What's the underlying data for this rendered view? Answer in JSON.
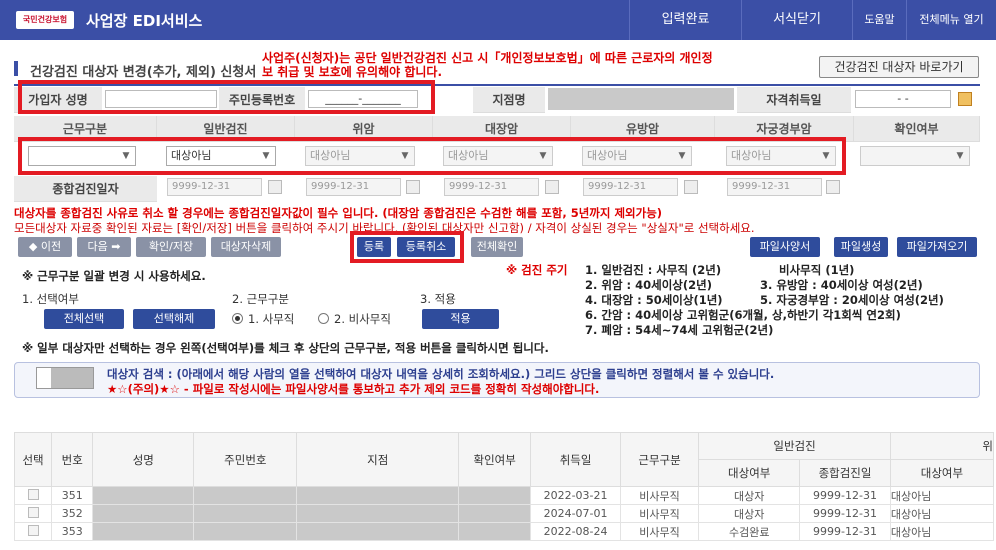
{
  "topbar": {
    "logo_text": "국민건강보험",
    "service": "사업장 EDI서비스",
    "menu": [
      "입력완료",
      "서식닫기",
      "도움말",
      "전체메뉴 열기"
    ]
  },
  "page": {
    "title": "건강검진 대상자 변경(추가, 제외) 신청서",
    "warning": "사업주(신청자)는 공단 일반건강검진 신고 시「개인정보보호법」에 따른 근로자의 개인정보 취급 및 보호에 유의해야 합니다.",
    "shortcut": "건강검진 대상자 바로가기"
  },
  "form": {
    "name_label": "가입자 성명",
    "rrn_label": "주민등록번호",
    "rrn_value": "______-_______",
    "branch_label": "지점명",
    "acq_label": "자격취득일",
    "acq_value": "-  -"
  },
  "columns": {
    "work": "근무구분",
    "general": "일반검진",
    "stomach": "위암",
    "colon": "대장암",
    "breast": "유방암",
    "cervical": "자궁경부암",
    "confirm": "확인여부",
    "combined": "종합검진일자"
  },
  "selects": {
    "general": "대상아님",
    "stomach": "대상아님",
    "colon": "대상아님",
    "breast": "대상아님",
    "cervical": "대상아님"
  },
  "dates": {
    "d1": "9999-12-31",
    "d2": "9999-12-31",
    "d3": "9999-12-31",
    "d4": "9999-12-31",
    "d5": "9999-12-31"
  },
  "notices": {
    "n1": "대상자를 종합검진 사유로 취소 할 경우에는 종합검진일자값이 필수 입니다. (대장암 종합검진은 수검한 해를 포함, 5년까지 제외가능)",
    "n2": "모든대상자 자료중 확인된 자료는 [확인/저장] 버튼을 클릭하여 주시기 바랍니다. (확인된 대상자만 신고함) / 자격이 상실된 경우는 \"상실자\"로 선택하세요."
  },
  "buttons": {
    "prev": "◆ 이전",
    "next": "다음 ➡",
    "confirm_save": "확인/저장",
    "delete": "대상자삭제",
    "register": "등록",
    "cancel_reg": "등록취소",
    "check_all": "전체확인",
    "file_spec": "파일사양서",
    "file_gen": "파일생성",
    "file_import": "파일가져오기",
    "select_all": "전체선택",
    "deselect": "선택해제",
    "apply": "적용"
  },
  "bulk": {
    "hint": "※ 근무구분 일괄 변경 시 사용하세요.",
    "step1": "1. 선택여부",
    "step2": "2. 근무구분",
    "step3": "3. 적용",
    "opt1": "1. 사무직",
    "opt2": "2. 비사무직",
    "hint2": "※ 일부 대상자만 선택하는 경우 왼쪽(선택여부)를 체크 후 상단의 근무구분, 적용 버튼을 클릭하시면 됩니다."
  },
  "cycle": {
    "label": "※ 검진 주기",
    "l1a": "1. 일반검진 : 사무직 (2년)",
    "l1b": "비사무직 (1년)",
    "l2a": "2. 위암 : 40세이상(2년)",
    "l2b": "3. 유방암 : 40세이상 여성(2년)",
    "l3a": "4. 대장암 : 50세이상(1년)",
    "l3b": "5. 자궁경부암 : 20세이상 여성(2년)",
    "l4": "6. 간암 : 40세이상 고위험군(6개월, 상,하반기 각1회씩 연2회)",
    "l5": "7. 폐암 : 54세~74세 고위험군(2년)"
  },
  "search": {
    "line1": "대상자 검색 : (아래에서 해당 사람의 열을 선택하여 대상자 내역을 상세히 조회하세요.) 그리드 상단을 클릭하면 정렬해서 볼 수 있습니다.",
    "line2": "★☆(주의)★☆ - 파일로 작성시에는 파일사양서를 통보하고 추가 제외 코드를 정확히 작성해야합니다."
  },
  "grid": {
    "headers": [
      "선택",
      "번호",
      "성명",
      "주민번호",
      "지점",
      "확인여부",
      "취득일",
      "근무구분",
      "일반검진",
      "위"
    ],
    "sub": [
      "대상여부",
      "종합검진일",
      "대상여부"
    ],
    "rows": [
      {
        "no": "351",
        "date": "2022-03-21",
        "work": "비사무직",
        "gen": "대상자",
        "gdate": "9999-12-31",
        "st": "대상아님"
      },
      {
        "no": "352",
        "date": "2024-07-01",
        "work": "비사무직",
        "gen": "대상자",
        "gdate": "9999-12-31",
        "st": "대상아님"
      },
      {
        "no": "353",
        "date": "2022-08-24",
        "work": "비사무직",
        "gen": "수검완료",
        "gdate": "9999-12-31",
        "st": "대상아님"
      }
    ]
  }
}
